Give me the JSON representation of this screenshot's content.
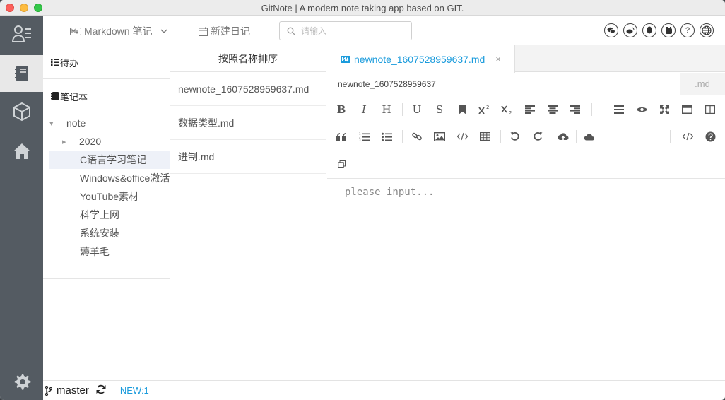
{
  "window": {
    "title": "GitNote | A modern note taking app based on GIT."
  },
  "sidebar": {
    "items": [
      {
        "icon": "user-list-icon"
      },
      {
        "icon": "notebook-icon"
      },
      {
        "icon": "cube-icon"
      },
      {
        "icon": "home-icon"
      },
      {
        "icon": "gear-icon"
      }
    ]
  },
  "toolbar": {
    "mode_label": "Markdown 笔记",
    "new_diary_label": "新建日记",
    "search_placeholder": "请输入",
    "social": [
      "wechat-icon",
      "weibo-icon",
      "qq-icon",
      "github-icon",
      "help-icon",
      "globe-icon"
    ],
    "help_glyph": "?"
  },
  "notebooks": {
    "todo_label": "待办",
    "notebook_label": "笔记本",
    "tree": [
      {
        "label": "note",
        "level": 0,
        "arrow": "▾"
      },
      {
        "label": "2020",
        "level": 1,
        "arrow": "▸"
      },
      {
        "label": "C语言学习笔记",
        "level": 2,
        "selected": true
      },
      {
        "label": "Windows&office激活",
        "level": 2
      },
      {
        "label": "YouTube素材",
        "level": 2
      },
      {
        "label": "科学上网",
        "level": 2
      },
      {
        "label": "系统安装",
        "level": 2
      },
      {
        "label": "薅羊毛",
        "level": 2
      }
    ]
  },
  "files": {
    "sort_label": "按照名称排序",
    "items": [
      "newnote_1607528959637.md",
      "数据类型.md",
      "进制.md"
    ]
  },
  "editor": {
    "tab_label": "newnote_1607528959637.md",
    "tab_close": "×",
    "filename_value": "newnote_1607528959637",
    "extension": ".md",
    "placeholder": "please input..."
  },
  "status": {
    "branch": "master",
    "new_label": "NEW:1"
  },
  "colors": {
    "accent": "#1a9bdc",
    "sidebar": "#545b62"
  }
}
